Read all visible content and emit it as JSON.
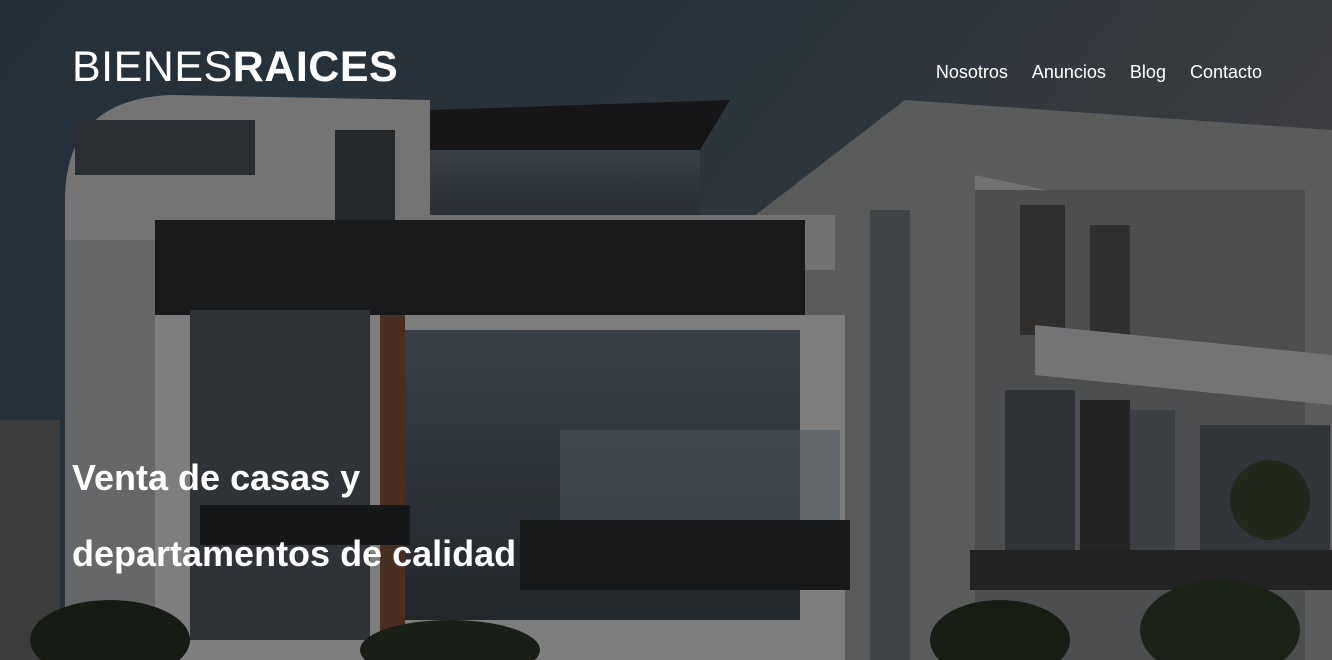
{
  "logo": {
    "light": "BIENES",
    "bold": "RAICES"
  },
  "nav": {
    "items": [
      "Nosotros",
      "Anuncios",
      "Blog",
      "Contacto"
    ]
  },
  "hero": {
    "headline_line1": "Venta de casas y",
    "headline_line2": "departamentos de calidad"
  },
  "colors": {
    "text": "#ffffff",
    "sky_top": "#2f3d48",
    "sky_bottom": "#4a4d52"
  },
  "icons": {
    "background": "modern-house-photo"
  }
}
